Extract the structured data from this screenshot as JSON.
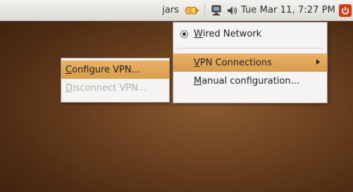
{
  "panel": {
    "user": "jars",
    "clock": "Tue Mar 11,  7:27 PM",
    "icons": [
      "user-switch-icon",
      "network-icon",
      "volume-icon",
      "power-icon"
    ]
  },
  "network_menu": {
    "wired": {
      "mnemonic": "W",
      "rest": "ired Network",
      "selected": true
    },
    "vpn": {
      "mnemonic": "V",
      "rest": "PN Connections"
    },
    "manual": {
      "mnemonic": "M",
      "rest": "anual configuration..."
    }
  },
  "vpn_submenu": {
    "configure": {
      "mnemonic": "C",
      "rest": "onfigure VPN..."
    },
    "disconnect": {
      "mnemonic": "D",
      "rest": "isconnect VPN...",
      "disabled": true
    }
  },
  "colors": {
    "highlight": "#d99c4a",
    "power": "#d73a0f"
  }
}
